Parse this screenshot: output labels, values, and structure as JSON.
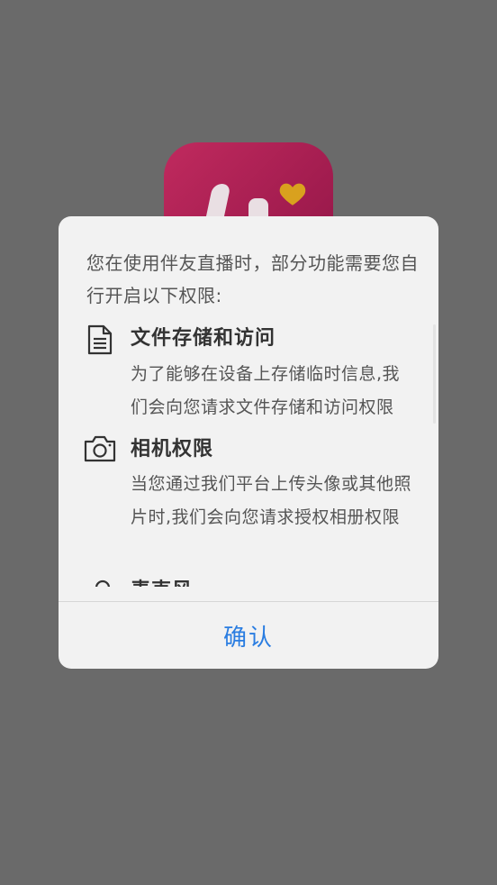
{
  "dialog": {
    "intro": "您在使用伴友直播时，部分功能需要您自行开启以下权限:",
    "permissions": [
      {
        "icon": "document-icon",
        "title": "文件存储和访问",
        "desc": "为了能够在设备上存储临时信息,我们会向您请求文件存储和访问权限"
      },
      {
        "icon": "camera-icon",
        "title": "相机权限",
        "desc": "当您通过我们平台上传头像或其他照片时,我们会向您请求授权相册权限"
      },
      {
        "icon": "microphone-icon",
        "title": "麦克风",
        "desc": ""
      }
    ],
    "confirm_label": "确认"
  },
  "colors": {
    "overlay": "#6a6a6a",
    "dialog_bg": "#f2f2f2",
    "accent": "#2a7de1",
    "app_icon": "#b02356"
  }
}
